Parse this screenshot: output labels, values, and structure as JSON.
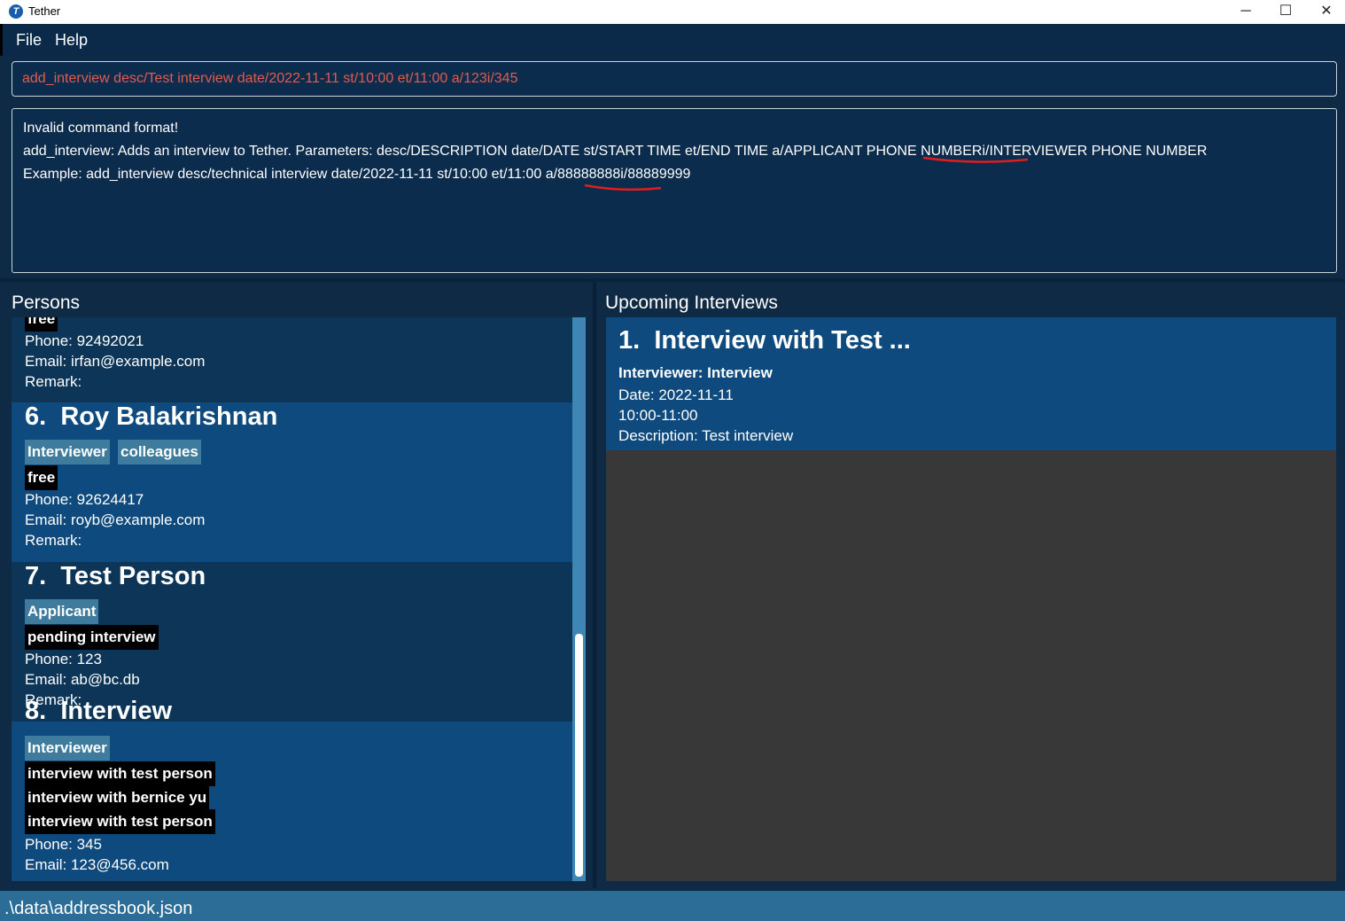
{
  "window": {
    "title": "Tether",
    "controls": {
      "minimize": "─",
      "maximize": "☐",
      "close": "✕"
    }
  },
  "menu": {
    "file": "File",
    "help": "Help"
  },
  "command_box": {
    "value": "add_interview desc/Test interview date/2022-11-11 st/10:00 et/11:00 a/123i/345"
  },
  "result_box": {
    "lines": [
      "Invalid command format!",
      "add_interview: Adds an interview to Tether. Parameters: desc/DESCRIPTION date/DATE st/START TIME et/END TIME a/APPLICANT PHONE NUMBERi/INTERVIEWER PHONE NUMBER",
      "Example: add_interview desc/technical interview date/2022-11-11 st/10:00 et/11:00 a/88888888i/88889999"
    ]
  },
  "persons_panel": {
    "title": "Persons",
    "cards": [
      {
        "status": "free",
        "phone": "Phone: 92492021",
        "email": "Email: irfan@example.com",
        "remark": "Remark:"
      },
      {
        "index": "6.",
        "name": "Roy Balakrishnan",
        "roles": [
          "Interviewer",
          "colleagues"
        ],
        "statuses": [
          "free"
        ],
        "phone": "Phone: 92624417",
        "email": "Email: royb@example.com",
        "remark": "Remark:"
      },
      {
        "index": "7.",
        "name": "Test Person",
        "roles": [
          "Applicant"
        ],
        "statuses": [
          "pending interview"
        ],
        "phone": "Phone: 123",
        "email": "Email: ab@bc.db",
        "remark": "Remark:"
      },
      {
        "index": "8.",
        "name": "Interview",
        "roles": [
          "Interviewer"
        ],
        "statuses": [
          "interview with test person",
          "interview with bernice yu",
          "interview with test person"
        ],
        "phone": "Phone: 345",
        "email": "Email: 123@456.com"
      }
    ]
  },
  "interviews_panel": {
    "title": "Upcoming Interviews",
    "cards": [
      {
        "index": "1.",
        "title": "Interview with Test ...",
        "interviewer": "Interviewer: Interview",
        "date": "Date: 2022-11-11",
        "time": "10:00-11:00",
        "description": "Description: Test interview"
      }
    ]
  },
  "status_bar": {
    "path": ".\\data\\addressbook.json"
  },
  "colors": {
    "background": "#0f2a44",
    "card_light": "#0e4a7d",
    "card_dark": "#0c3558",
    "role_tag": "#3e7b9d",
    "status_tag": "#000000",
    "error_text": "#e35a4f",
    "annotation_red": "#e01e1e"
  }
}
